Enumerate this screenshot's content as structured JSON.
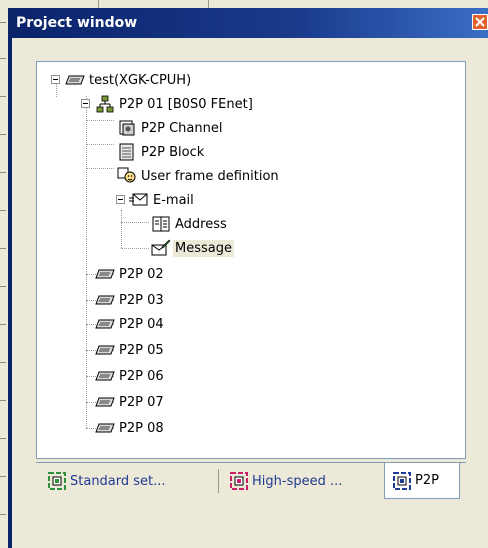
{
  "window": {
    "title": "Project window"
  },
  "tree": {
    "root": {
      "label": "test(XGK-CPUH)",
      "icon": "plc-module-icon"
    },
    "p2p01": {
      "label": "P2P 01 [B0S0 FEnet]",
      "icon": "network-icon"
    },
    "children": [
      {
        "label": "P2P Channel",
        "icon": "channel-icon"
      },
      {
        "label": "P2P Block",
        "icon": "block-icon"
      },
      {
        "label": "User frame definition",
        "icon": "user-frame-icon"
      }
    ],
    "email": {
      "label": "E-mail",
      "icon": "email-icon"
    },
    "email_children": [
      {
        "label": "Address",
        "icon": "address-book-icon"
      },
      {
        "label": "Message",
        "icon": "message-icon",
        "selected": true
      }
    ],
    "others": [
      {
        "label": "P2P 02"
      },
      {
        "label": "P2P 03"
      },
      {
        "label": "P2P 04"
      },
      {
        "label": "P2P 05"
      },
      {
        "label": "P2P 06"
      },
      {
        "label": "P2P 07"
      },
      {
        "label": "P2P 08"
      }
    ]
  },
  "tabs": [
    {
      "label": "Standard set...",
      "icon": "standard-settings-icon",
      "accent": "#2f8f3a"
    },
    {
      "label": "High-speed ...",
      "icon": "high-speed-link-icon",
      "accent": "#c8206a"
    },
    {
      "label": "P2P",
      "icon": "p2p-icon",
      "accent": "#1f3a93",
      "active": true
    }
  ],
  "colors": {
    "titlebar": "#0a246a",
    "close": "#e2622b",
    "selection": "#ece9d8"
  }
}
